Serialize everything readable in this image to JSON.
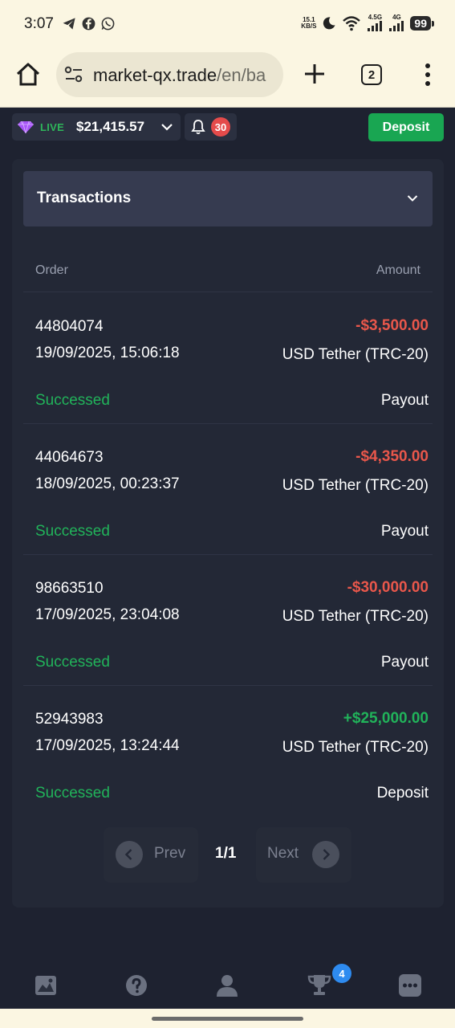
{
  "status_bar": {
    "time": "3:07",
    "net_speed_value": "15.1",
    "net_speed_unit": "KB/S",
    "sig1_label": "4.5G",
    "sig2_label": "4G",
    "battery": "99",
    "left_icons": [
      "telegram-icon",
      "facebook-icon",
      "whatsapp-icon"
    ],
    "right_icons": [
      "moon-icon",
      "wifi-icon",
      "signal-icon",
      "signal-icon"
    ]
  },
  "browser": {
    "url_host": "market-qx.trade",
    "url_path": "/en/ba",
    "tab_count": "2"
  },
  "app_bar": {
    "account_mode": "LIVE",
    "balance": "$21,415.57",
    "notifications_count": "30",
    "deposit_label": "Deposit"
  },
  "transactions": {
    "title": "Transactions",
    "columns": {
      "order": "Order",
      "amount": "Amount"
    },
    "rows": [
      {
        "order_id": "44804074",
        "datetime": "19/09/2025, 15:06:18",
        "status": "Successed",
        "amount": "-$3,500.00",
        "amount_sign": "negative",
        "method": "USD Tether (TRC-20)",
        "type": "Payout"
      },
      {
        "order_id": "44064673",
        "datetime": "18/09/2025, 00:23:37",
        "status": "Successed",
        "amount": "-$4,350.00",
        "amount_sign": "negative",
        "method": "USD Tether (TRC-20)",
        "type": "Payout"
      },
      {
        "order_id": "98663510",
        "datetime": "17/09/2025, 23:04:08",
        "status": "Successed",
        "amount": "-$30,000.00",
        "amount_sign": "negative",
        "method": "USD Tether (TRC-20)",
        "type": "Payout"
      },
      {
        "order_id": "52943983",
        "datetime": "17/09/2025, 13:24:44",
        "status": "Successed",
        "amount": "+$25,000.00",
        "amount_sign": "positive",
        "method": "USD Tether (TRC-20)",
        "type": "Deposit"
      }
    ],
    "pagination": {
      "prev_label": "Prev",
      "next_label": "Next",
      "page_indicator": "1/1"
    }
  },
  "bottom_nav": {
    "items": [
      "chart-icon",
      "help-icon",
      "profile-icon",
      "trophy-icon",
      "chat-icon"
    ],
    "trophy_badge": "4"
  },
  "colors": {
    "background": "#1e2230",
    "card": "#232836",
    "accent_green": "#19a652",
    "status_green": "#21b35a",
    "negative_red": "#e9574b",
    "badge_red": "#e44b4b",
    "badge_blue": "#2e8bf0"
  }
}
